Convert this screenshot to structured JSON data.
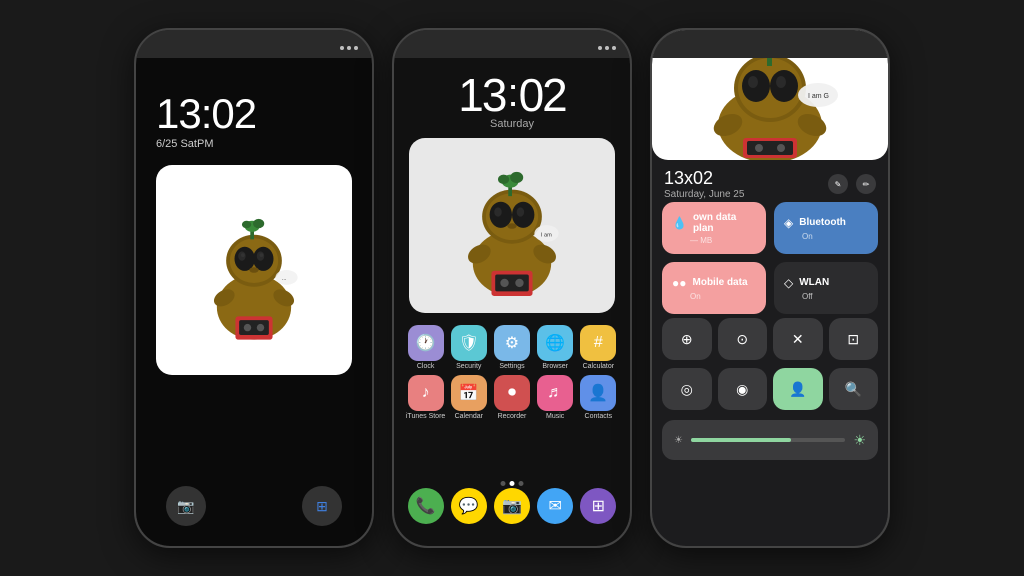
{
  "background": "#1a1a1a",
  "phones": {
    "phone1": {
      "time": "13:02",
      "date": "6/25 SatPM",
      "type": "lockscreen"
    },
    "phone2": {
      "time_h": "13",
      "time_m": "02",
      "day": "Saturday",
      "type": "homescreen",
      "apps_row1": [
        {
          "label": "Clock",
          "color": "#9b8dd4",
          "icon": "🕐"
        },
        {
          "label": "Security",
          "color": "#5bc8d4",
          "icon": "🛡"
        },
        {
          "label": "Settings",
          "color": "#7ab8e8",
          "icon": "✕"
        },
        {
          "label": "Browser",
          "color": "#5bc0e8",
          "icon": "🌐"
        },
        {
          "label": "Calculator",
          "color": "#f0c040",
          "icon": "#"
        }
      ],
      "apps_row2": [
        {
          "label": "iTunes Store",
          "color": "#e88080",
          "icon": "♪"
        },
        {
          "label": "Calendar",
          "color": "#e8a060",
          "icon": "📅"
        },
        {
          "label": "Recorder",
          "color": "#d05050",
          "icon": "⏺"
        },
        {
          "label": "Music",
          "color": "#e86090",
          "icon": "♬"
        },
        {
          "label": "Contacts",
          "color": "#6090e8",
          "icon": "👤"
        }
      ],
      "dock": [
        {
          "icon": "📞",
          "color": "#4CAF50"
        },
        {
          "icon": "💬",
          "color": "#FFD700"
        },
        {
          "icon": "📷",
          "color": "#FFD700"
        },
        {
          "icon": "✉",
          "color": "#42A5F5"
        },
        {
          "icon": "⊞",
          "color": "#7E57C2"
        }
      ]
    },
    "phone3": {
      "time": "13x02",
      "date": "Saturday, June 25",
      "type": "controlcenter",
      "tiles": [
        {
          "label": "own data plan",
          "sublabel": "— MB",
          "icon": "💧",
          "style": "pink"
        },
        {
          "label": "Bluetooth",
          "sublabel": "On",
          "icon": "◈",
          "style": "blue"
        },
        {
          "label": "Mobile data",
          "sublabel": "On",
          "icon": "●●",
          "style": "pink"
        },
        {
          "label": "WLAN",
          "sublabel": "Off",
          "icon": "◇",
          "style": "dark"
        }
      ],
      "small_btns_row1": [
        "⊕",
        "⊙",
        "✕",
        "⊡"
      ],
      "small_btns_row2": [
        "◎",
        "◉",
        "👤",
        "🔍"
      ],
      "brightness_level": 65
    }
  }
}
